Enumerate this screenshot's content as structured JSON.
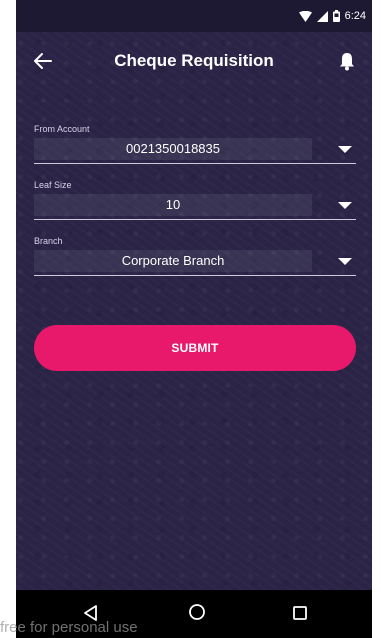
{
  "status_bar": {
    "time": "6:24",
    "icons": [
      "wifi-icon",
      "signal-icon",
      "battery-icon"
    ]
  },
  "app_bar": {
    "title": "Cheque Requisition",
    "icons": [
      "back-arrow-icon",
      "bell-icon"
    ]
  },
  "form": {
    "fields": [
      {
        "label": "From Account",
        "value": "0021350018835"
      },
      {
        "label": "Leaf Size",
        "value": "10"
      },
      {
        "label": "Branch",
        "value": "Corporate Branch"
      }
    ]
  },
  "submit_label": "SUBMIT",
  "nav_bar": {
    "icons": [
      "nav-back-icon",
      "nav-home-icon",
      "nav-recent-icon"
    ]
  },
  "watermark": "free for personal use",
  "colors": {
    "background": "#2b2447",
    "accent": "#e8196a",
    "status_bar": "#1e1933",
    "nav_bar": "#000000"
  }
}
